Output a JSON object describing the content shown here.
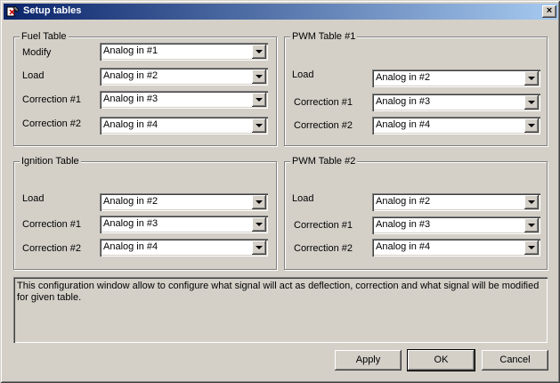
{
  "window": {
    "title": "Setup tables",
    "close_label": "×"
  },
  "groups": {
    "fuel": {
      "title": "Fuel Table",
      "rows": [
        {
          "label": "Modify",
          "value": "Analog in #1"
        },
        {
          "label": "Load",
          "value": "Analog in #2"
        },
        {
          "label": "Correction #1",
          "value": "Analog in #3"
        },
        {
          "label": "Correction #2",
          "value": "Analog in #4"
        }
      ]
    },
    "pwm1": {
      "title": "PWM Table #1",
      "rows": [
        {
          "label": "Load",
          "value": "Analog in #2"
        },
        {
          "label": "Correction #1",
          "value": "Analog in #3"
        },
        {
          "label": "Correction #2",
          "value": "Analog in #4"
        }
      ]
    },
    "ignition": {
      "title": "Ignition Table",
      "rows": [
        {
          "label": "Load",
          "value": "Analog in #2"
        },
        {
          "label": "Correction #1",
          "value": "Analog in #3"
        },
        {
          "label": "Correction #2",
          "value": "Analog in #4"
        }
      ]
    },
    "pwm2": {
      "title": "PWM Table #2",
      "rows": [
        {
          "label": "Load",
          "value": "Analog in #2"
        },
        {
          "label": "Correction #1",
          "value": "Analog in #3"
        },
        {
          "label": "Correction #2",
          "value": "Analog in #4"
        }
      ]
    }
  },
  "description": "This configuration window allow to configure what signal will act as deflection, correction and what signal will be modified for given table.",
  "buttons": {
    "apply": "Apply",
    "ok": "OK",
    "cancel": "Cancel"
  }
}
